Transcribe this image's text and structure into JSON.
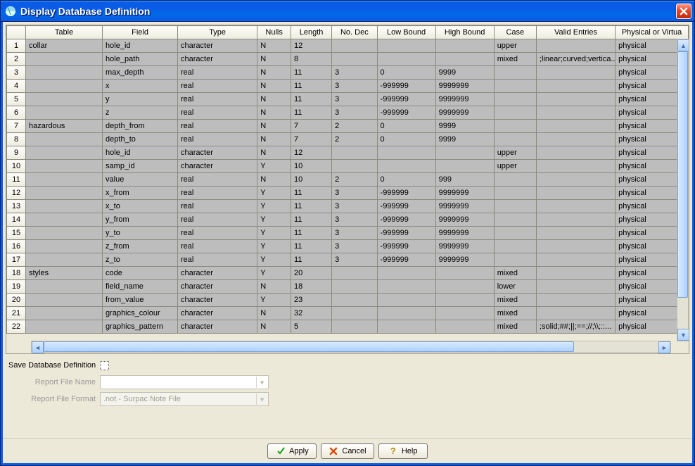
{
  "window": {
    "title": "Display Database Definition"
  },
  "columns": [
    "Table",
    "Field",
    "Type",
    "Nulls",
    "Length",
    "No. Dec",
    "Low Bound",
    "High Bound",
    "Case",
    "Valid Entries",
    "Physical or Virtual"
  ],
  "rows": [
    {
      "n": 1,
      "table": "collar",
      "field": "hole_id",
      "type": "character",
      "nulls": "N",
      "length": "12",
      "dec": "",
      "low": "",
      "high": "",
      "case": "upper",
      "valid": "",
      "pv": "physical"
    },
    {
      "n": 2,
      "table": "",
      "field": "hole_path",
      "type": "character",
      "nulls": "N",
      "length": "8",
      "dec": "",
      "low": "",
      "high": "",
      "case": "mixed",
      "valid": ";linear;curved;vertica...",
      "pv": "physical"
    },
    {
      "n": 3,
      "table": "",
      "field": "max_depth",
      "type": "real",
      "nulls": "N",
      "length": "11",
      "dec": "3",
      "low": "0",
      "high": "9999",
      "case": "",
      "valid": "",
      "pv": "physical"
    },
    {
      "n": 4,
      "table": "",
      "field": "x",
      "type": "real",
      "nulls": "N",
      "length": "11",
      "dec": "3",
      "low": "-999999",
      "high": "9999999",
      "case": "",
      "valid": "",
      "pv": "physical"
    },
    {
      "n": 5,
      "table": "",
      "field": "y",
      "type": "real",
      "nulls": "N",
      "length": "11",
      "dec": "3",
      "low": "-999999",
      "high": "9999999",
      "case": "",
      "valid": "",
      "pv": "physical"
    },
    {
      "n": 6,
      "table": "",
      "field": "z",
      "type": "real",
      "nulls": "N",
      "length": "11",
      "dec": "3",
      "low": "-999999",
      "high": "9999999",
      "case": "",
      "valid": "",
      "pv": "physical"
    },
    {
      "n": 7,
      "table": "hazardous",
      "field": "depth_from",
      "type": "real",
      "nulls": "N",
      "length": "7",
      "dec": "2",
      "low": "0",
      "high": "9999",
      "case": "",
      "valid": "",
      "pv": "physical"
    },
    {
      "n": 8,
      "table": "",
      "field": "depth_to",
      "type": "real",
      "nulls": "N",
      "length": "7",
      "dec": "2",
      "low": "0",
      "high": "9999",
      "case": "",
      "valid": "",
      "pv": "physical"
    },
    {
      "n": 9,
      "table": "",
      "field": "hole_id",
      "type": "character",
      "nulls": "N",
      "length": "12",
      "dec": "",
      "low": "",
      "high": "",
      "case": "upper",
      "valid": "",
      "pv": "physical"
    },
    {
      "n": 10,
      "table": "",
      "field": "samp_id",
      "type": "character",
      "nulls": "Y",
      "length": "10",
      "dec": "",
      "low": "",
      "high": "",
      "case": "upper",
      "valid": "",
      "pv": "physical"
    },
    {
      "n": 11,
      "table": "",
      "field": "value",
      "type": "real",
      "nulls": "N",
      "length": "10",
      "dec": "2",
      "low": "0",
      "high": "999",
      "case": "",
      "valid": "",
      "pv": "physical"
    },
    {
      "n": 12,
      "table": "",
      "field": "x_from",
      "type": "real",
      "nulls": "Y",
      "length": "11",
      "dec": "3",
      "low": "-999999",
      "high": "9999999",
      "case": "",
      "valid": "",
      "pv": "physical"
    },
    {
      "n": 13,
      "table": "",
      "field": "x_to",
      "type": "real",
      "nulls": "Y",
      "length": "11",
      "dec": "3",
      "low": "-999999",
      "high": "9999999",
      "case": "",
      "valid": "",
      "pv": "physical"
    },
    {
      "n": 14,
      "table": "",
      "field": "y_from",
      "type": "real",
      "nulls": "Y",
      "length": "11",
      "dec": "3",
      "low": "-999999",
      "high": "9999999",
      "case": "",
      "valid": "",
      "pv": "physical"
    },
    {
      "n": 15,
      "table": "",
      "field": "y_to",
      "type": "real",
      "nulls": "Y",
      "length": "11",
      "dec": "3",
      "low": "-999999",
      "high": "9999999",
      "case": "",
      "valid": "",
      "pv": "physical"
    },
    {
      "n": 16,
      "table": "",
      "field": "z_from",
      "type": "real",
      "nulls": "Y",
      "length": "11",
      "dec": "3",
      "low": "-999999",
      "high": "9999999",
      "case": "",
      "valid": "",
      "pv": "physical"
    },
    {
      "n": 17,
      "table": "",
      "field": "z_to",
      "type": "real",
      "nulls": "Y",
      "length": "11",
      "dec": "3",
      "low": "-999999",
      "high": "9999999",
      "case": "",
      "valid": "",
      "pv": "physical"
    },
    {
      "n": 18,
      "table": "styles",
      "field": "code",
      "type": "character",
      "nulls": "Y",
      "length": "20",
      "dec": "",
      "low": "",
      "high": "",
      "case": "mixed",
      "valid": "",
      "pv": "physical"
    },
    {
      "n": 19,
      "table": "",
      "field": "field_name",
      "type": "character",
      "nulls": "N",
      "length": "18",
      "dec": "",
      "low": "",
      "high": "",
      "case": "lower",
      "valid": "",
      "pv": "physical"
    },
    {
      "n": 20,
      "table": "",
      "field": "from_value",
      "type": "character",
      "nulls": "Y",
      "length": "23",
      "dec": "",
      "low": "",
      "high": "",
      "case": "mixed",
      "valid": "",
      "pv": "physical"
    },
    {
      "n": 21,
      "table": "",
      "field": "graphics_colour",
      "type": "character",
      "nulls": "N",
      "length": "32",
      "dec": "",
      "low": "",
      "high": "",
      "case": "mixed",
      "valid": "",
      "pv": "physical"
    },
    {
      "n": 22,
      "table": "",
      "field": "graphics_pattern",
      "type": "character",
      "nulls": "N",
      "length": "5",
      "dec": "",
      "low": "",
      "high": "",
      "case": "mixed",
      "valid": ";solid;##;||;==;//;\\\\;::...",
      "pv": "physical"
    }
  ],
  "form": {
    "save_label": "Save Database Definition",
    "report_name_label": "Report File Name",
    "report_format_label": "Report File Format",
    "report_format_value": ".not - Surpac Note File"
  },
  "buttons": {
    "apply": "Apply",
    "cancel": "Cancel",
    "help": "Help"
  }
}
